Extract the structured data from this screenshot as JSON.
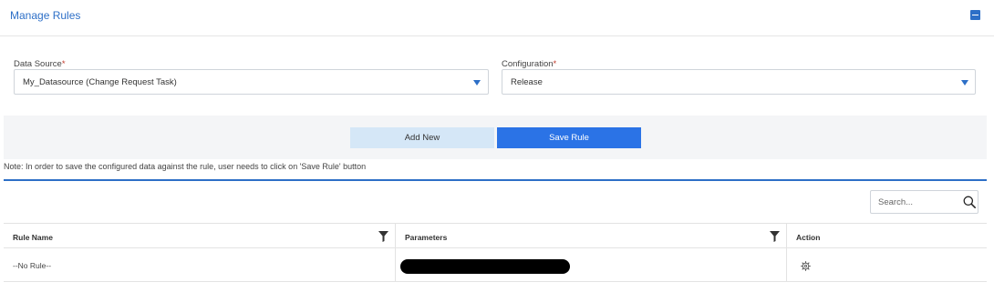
{
  "header": {
    "title": "Manage Rules",
    "collapse_icon": "minus-square-icon",
    "accent_color": "#2d6fc7"
  },
  "form": {
    "data_source": {
      "label": "Data Source",
      "required_marker": "*",
      "value": "My_Datasource (Change Request Task)"
    },
    "configuration": {
      "label": "Configuration",
      "required_marker": "*",
      "value": "Release"
    }
  },
  "actions": {
    "add_new_label": "Add New",
    "save_rule_label": "Save Rule",
    "save_color": "#2b73e6"
  },
  "note": "Note: In order to save the configured data against the rule, user needs to click on 'Save Rule' button",
  "search": {
    "placeholder": "Search...",
    "icon": "search-icon"
  },
  "table": {
    "columns": [
      {
        "label": "Rule Name",
        "filter_icon": "filter-icon"
      },
      {
        "label": "Parameters",
        "filter_icon": "filter-icon"
      },
      {
        "label": "Action"
      }
    ],
    "rows": [
      {
        "rule_name": "--No Rule--",
        "parameters": "[redacted]",
        "action_icon": "gear-icon"
      }
    ]
  }
}
